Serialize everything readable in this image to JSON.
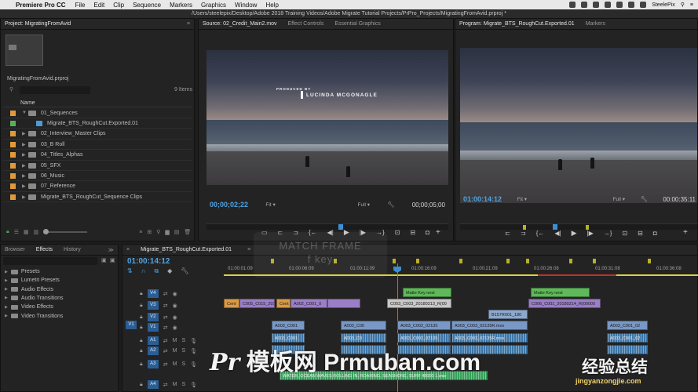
{
  "menubar": {
    "app": "Premiere Pro CC",
    "items": [
      "File",
      "Edit",
      "Clip",
      "Sequence",
      "Markers",
      "Graphics",
      "Window",
      "Help"
    ],
    "user": "SteelePix"
  },
  "titlebar": {
    "path": "/Users/steelepix/Desktop/Adobe 2018 Training Videos/Adobe Migrate Tutorial Projects/PrPro_Projects/MigratingFromAvid.prproj *"
  },
  "project": {
    "tab": "Project: MigratingFromAvid",
    "file": "MigratingFromAvid.prproj",
    "item_count": "9 Items",
    "column_name": "Name",
    "rows": [
      {
        "label": "01_Sequences",
        "color": "#e19a3a",
        "kind": "folder",
        "open": true
      },
      {
        "label": "Migrate_BTS_RoughCut.Exported.01",
        "color": "#58b158",
        "kind": "sequence",
        "indent": true
      },
      {
        "label": "02_Interview_Master Clips",
        "color": "#e19a3a",
        "kind": "folder"
      },
      {
        "label": "03_B Roll",
        "color": "#e19a3a",
        "kind": "folder"
      },
      {
        "label": "04_Titles_Alphas",
        "color": "#e19a3a",
        "kind": "folder"
      },
      {
        "label": "05_SFX",
        "color": "#e19a3a",
        "kind": "folder"
      },
      {
        "label": "06_Music",
        "color": "#e19a3a",
        "kind": "folder"
      },
      {
        "label": "07_Reference",
        "color": "#e19a3a",
        "kind": "folder"
      },
      {
        "label": "Migrate_BTS_RoughCut_Sequence Clips",
        "color": "#e19a3a",
        "kind": "folder"
      }
    ]
  },
  "source": {
    "tabs": [
      "Source: 02_Credit_Main2.mov",
      "Effect Controls",
      "Essential Graphics"
    ],
    "credit_small": "PRODUCED BY",
    "credit_name": "LUCINDA MCGONAGLE",
    "timecode": "00;00;02;22",
    "fit": "Fit",
    "quality": "Full",
    "duration": "00;00;05;00",
    "playhead_fraction": 0.56
  },
  "program": {
    "tabs": [
      "Program: Migrate_BTS_RoughCut.Exported.01",
      "Markers"
    ],
    "timecode": "01:00:14:12",
    "fit": "Fit",
    "quality": "Full",
    "duration": "00:00:35:11",
    "playhead_fraction": 0.4
  },
  "effects": {
    "tabs": [
      "Browser",
      "Effects",
      "History"
    ],
    "items": [
      "Presets",
      "Lumetri Presets",
      "Audio Effects",
      "Audio Transitions",
      "Video Effects",
      "Video Transitions"
    ]
  },
  "timeline": {
    "tab": "Migrate_BTS_RoughCut.Exported.01",
    "timecode": "01:00:14:12",
    "ticks": [
      "01:00:01:09",
      "01:00:06:09",
      "01:00:11:09",
      "01:00:16:09",
      "01:00:21:09",
      "01:00:26:08",
      "01:00:31:08",
      "01:00:36:08"
    ],
    "tracks": [
      "V4",
      "V3",
      "V2",
      "V1",
      "A1",
      "A2",
      "A3",
      "A4"
    ],
    "source_patch": "V1",
    "clips": {
      "v4_a": "Matte Key nest",
      "v4_b": "Matte Key nest",
      "v3_a": "Cent",
      "v3_b": "C005_C015_201",
      "v3_c": "Cent",
      "v3_d": "A002_C001_0",
      "v3_e": "C003_C003_20180213_R(00",
      "v3_f": "C006_C001_20180214_R(00000",
      "v2_a": "B157R001_180",
      "v1_a": "A003_C001",
      "v1_b": "A003_C00",
      "v1_c": "A003_C002_02135",
      "v1_d": "A003_C003_02135R.mov",
      "v1_e": "A003_C001_02",
      "a1_a": "A003_C001",
      "a1_b": "A003_C0",
      "a1_c": "A003_C002_02135",
      "a1_d": "A003_C003_02135R.mov",
      "a1_e": "A003_C001_02",
      "a4_a": "WATER, OCEAN WAVES ROLLING IN, ROARING, SEASHORE, SURF 48000 1.wav"
    }
  },
  "overlays": {
    "match_frame": "MATCH FRAME",
    "match_key": "f key",
    "watermark_cn": "模板网",
    "watermark_site": "Prmuban.com",
    "watermark_right": "经验总结",
    "watermark_url": "jingyanzongjie.com"
  },
  "colors": {
    "accent": "#4fa3e3",
    "folder": "#e19a3a",
    "sequence": "#58b158"
  }
}
